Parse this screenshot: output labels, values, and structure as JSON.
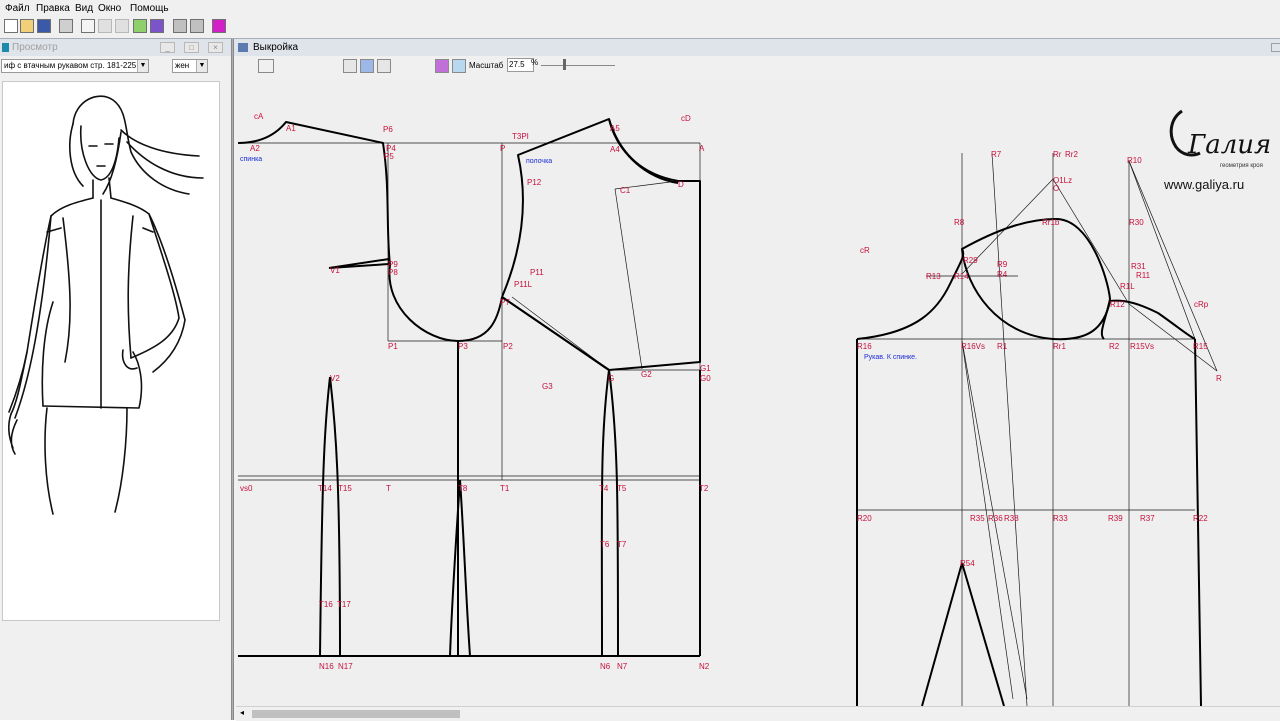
{
  "menu": [
    "Файл",
    "Правка",
    "Вид",
    "Окно",
    "Помощь"
  ],
  "preview_window": {
    "title": "Просмотр",
    "model_select_value": "иф с втачным рукавом стр. 181-225",
    "gender_select_value": "жен"
  },
  "pattern_window": {
    "title": "Выкройка",
    "scale_label": "Масштаб",
    "scale_value": "27.5",
    "scale_unit": "%",
    "back_label": "спинка",
    "front_label": "полочка",
    "sleeve_label": "Рукав. К спинке."
  },
  "logo": {
    "text": "Галия",
    "subtitle": "геометрия кроя",
    "url": "www.galiya.ru"
  },
  "point_labels": [
    "cA",
    "A2",
    "A1",
    "P6",
    "P4",
    "P5",
    "T3PI",
    "cD",
    "A",
    "A4",
    "A5",
    "C1",
    "D",
    "P12",
    "P11",
    "P11L",
    "V1",
    "P9",
    "P8",
    "P7",
    "P1",
    "P3",
    "P2",
    "P",
    "G1",
    "G0",
    "G",
    "G2",
    "G3",
    "V2",
    "T",
    "T1",
    "T8",
    "T2",
    "T4",
    "T5",
    "T6",
    "T7",
    "T16",
    "T17",
    "T14",
    "T15",
    "vs0",
    "N16",
    "N17",
    "N6",
    "N7",
    "N2",
    "R7",
    "Rr",
    "Rr2",
    "R10",
    "O1Lz",
    "O",
    "R8",
    "R30",
    "R29",
    "R9",
    "R4",
    "R13",
    "R14",
    "R31",
    "R11",
    "R1L",
    "R12",
    "R1",
    "R2",
    "R16",
    "R15",
    "R15Vs",
    "R16Vs",
    "Rr1",
    "Rr1b",
    "cR",
    "cRp",
    "R",
    "R20",
    "R22",
    "R33",
    "R35",
    "R36",
    "R37",
    "R38",
    "R39",
    "R54"
  ],
  "colors": {
    "label_red": "#c8103c",
    "label_blue": "#1a2bd8",
    "canvas_bg": "#efefef",
    "mdi_bg": "#a8aeb8"
  },
  "icons": [
    "new-icon",
    "open-icon",
    "save-icon",
    "print-icon",
    "preview-icon",
    "copy-icon",
    "paste-icon",
    "grid-icon",
    "color-icon",
    "hand-icon",
    "select-icon",
    "pointer-icon",
    "zoom-icon",
    "cursor-icon"
  ]
}
